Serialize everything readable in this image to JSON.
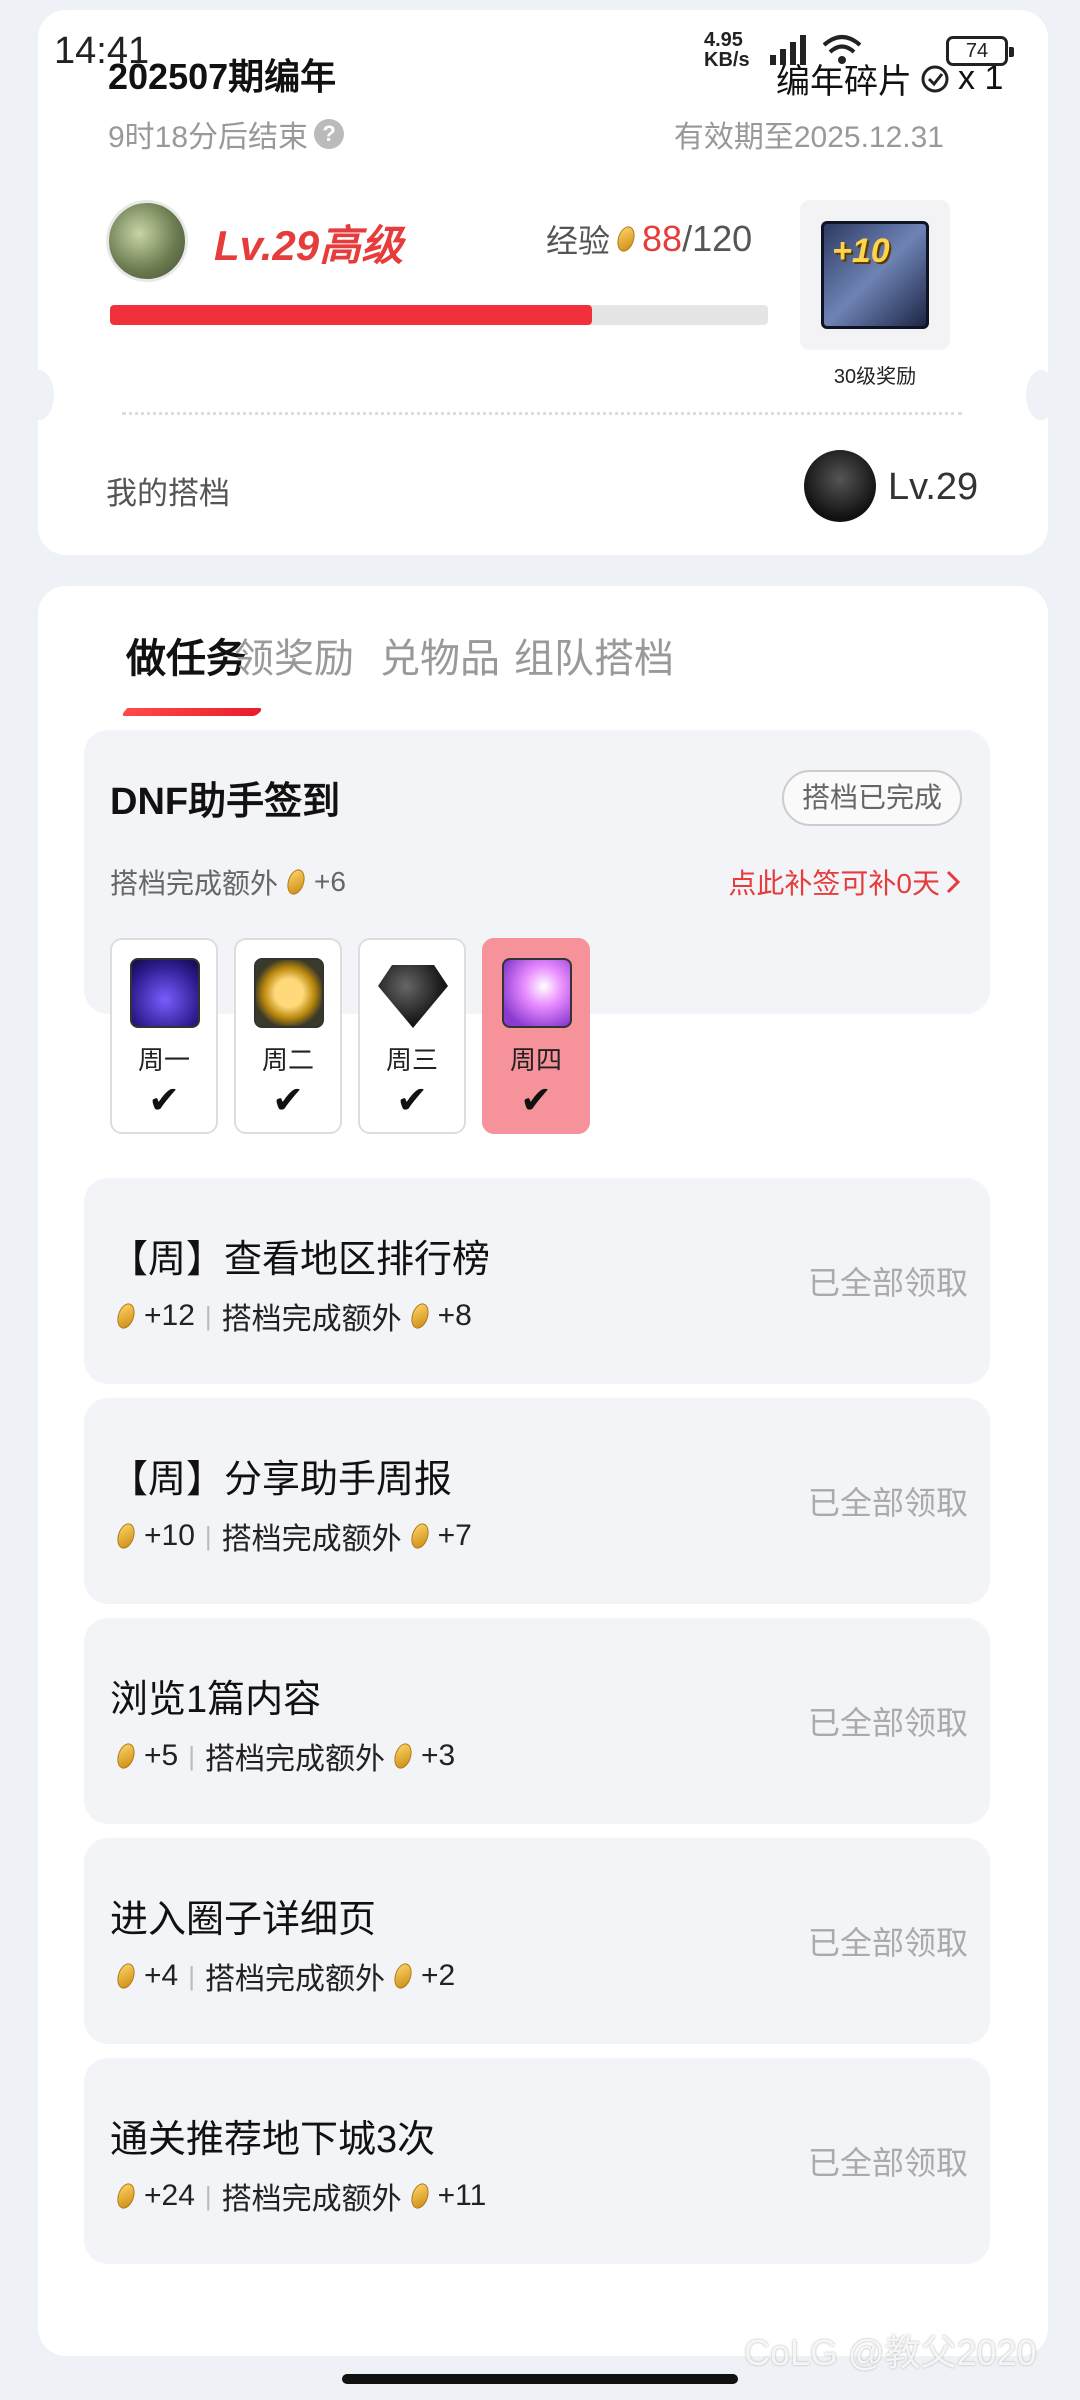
{
  "status_bar": {
    "time": "14:41",
    "net_speed_value": "4.95",
    "net_speed_unit": "KB/s",
    "battery": "74"
  },
  "header": {
    "season_title": "202507期编年",
    "ends_in": "9时18分后结束",
    "help_symbol": "?",
    "shards_label": "编年碎片",
    "shards_count": "x 1",
    "validity": "有效期至2025.12.31"
  },
  "level": {
    "label": "Lv.29高级",
    "exp_label": "经验",
    "exp_current": "88",
    "exp_max": "/120",
    "exp_fraction": 0.733,
    "reward_badge": "+10",
    "reward_label": "30级奖励"
  },
  "partner": {
    "label": "我的搭档",
    "level": "Lv.29"
  },
  "tabs": [
    {
      "label": "做任务",
      "active": true
    },
    {
      "label": "领奖励",
      "active": false
    },
    {
      "label": "兑物品",
      "active": false
    },
    {
      "label": "组队搭档",
      "active": false
    }
  ],
  "signin_task": {
    "title": "DNF助手签到",
    "badge": "搭档已完成",
    "bonus_label": "搭档完成额外",
    "bonus_value": "+6",
    "makeup_text": "点此补签可补0天",
    "days": [
      {
        "name": "周一",
        "check": "✔",
        "icon": "purple-bag-icon"
      },
      {
        "name": "周二",
        "check": "✔",
        "icon": "gold-coin-icon"
      },
      {
        "name": "周三",
        "check": "✔",
        "icon": "black-gem-icon"
      },
      {
        "name": "周四",
        "check": "✔",
        "icon": "pink-crystal-icon"
      }
    ]
  },
  "tasks": [
    {
      "name": "【周】查看地区排行榜",
      "reward": "+12",
      "bonus_label": "搭档完成额外",
      "bonus": "+8",
      "status": "已全部领取"
    },
    {
      "name": "【周】分享助手周报",
      "reward": "+10",
      "bonus_label": "搭档完成额外",
      "bonus": "+7",
      "status": "已全部领取"
    },
    {
      "name": "浏览1篇内容",
      "reward": "+5",
      "bonus_label": "搭档完成额外",
      "bonus": "+3",
      "status": "已全部领取"
    },
    {
      "name": "进入圈子详细页",
      "reward": "+4",
      "bonus_label": "搭档完成额外",
      "bonus": "+2",
      "status": "已全部领取"
    },
    {
      "name": "通关推荐地下城3次",
      "reward": "+24",
      "bonus_label": "搭档完成额外",
      "bonus": "+11",
      "status": "已全部领取"
    }
  ],
  "watermark": "CoLG @教父2020",
  "colors": {
    "accent": "#e63c3c",
    "bar_fill": "#f0303a",
    "today": "#f6929a",
    "bg": "#eef1f6"
  }
}
